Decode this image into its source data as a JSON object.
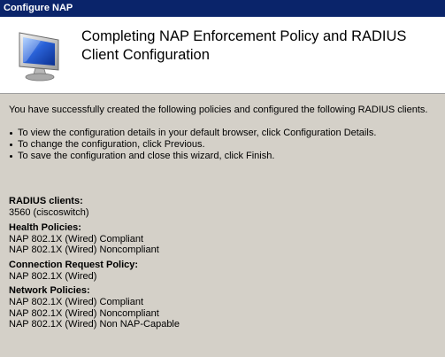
{
  "window": {
    "title": "Configure NAP"
  },
  "header": {
    "title": "Completing NAP Enforcement Policy and RADIUS Client Configuration",
    "icon": "monitor-icon"
  },
  "intro": "You have successfully created the following policies and configured the following RADIUS clients.",
  "bullets": [
    "To view the configuration details in your default browser, click Configuration Details.",
    "To change the configuration, click Previous.",
    "To save the configuration and close this wizard, click Finish."
  ],
  "sections": {
    "radius": {
      "title": "RADIUS clients:",
      "lines": [
        "3560 (ciscoswitch)"
      ]
    },
    "health": {
      "title": "Health Policies:",
      "lines": [
        "NAP 802.1X (Wired) Compliant",
        "NAP 802.1X (Wired) Noncompliant"
      ]
    },
    "connection": {
      "title": "Connection Request Policy:",
      "lines": [
        "NAP 802.1X (Wired)"
      ]
    },
    "network": {
      "title": "Network Policies:",
      "lines": [
        "NAP 802.1X (Wired) Compliant",
        "NAP 802.1X (Wired) Noncompliant",
        "NAP 802.1X (Wired) Non NAP-Capable"
      ]
    }
  },
  "colors": {
    "titlebar": "#0a246a",
    "background": "#d4d0c8",
    "header": "#ffffff"
  }
}
